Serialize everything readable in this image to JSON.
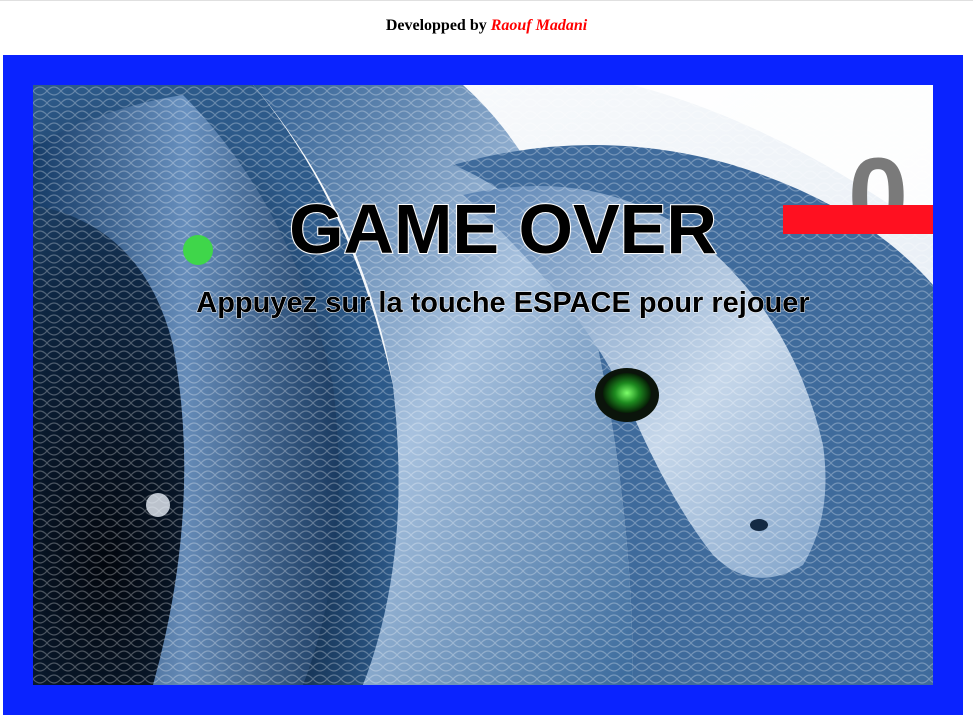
{
  "header": {
    "prefix": "Developped by",
    "author": "Raouf Madani"
  },
  "game": {
    "score": "0",
    "over_title": "GAME OVER",
    "replay_message": "Appuyez sur la touche ESPACE pour rejouer"
  },
  "colors": {
    "frame": "#0a23ff",
    "snake": "#ff1020",
    "food": "#3fd64a",
    "author": "#ff0000",
    "score": "#7a7a7a"
  },
  "icons": {
    "background": "python-snake-image",
    "food": "apple-dot"
  }
}
